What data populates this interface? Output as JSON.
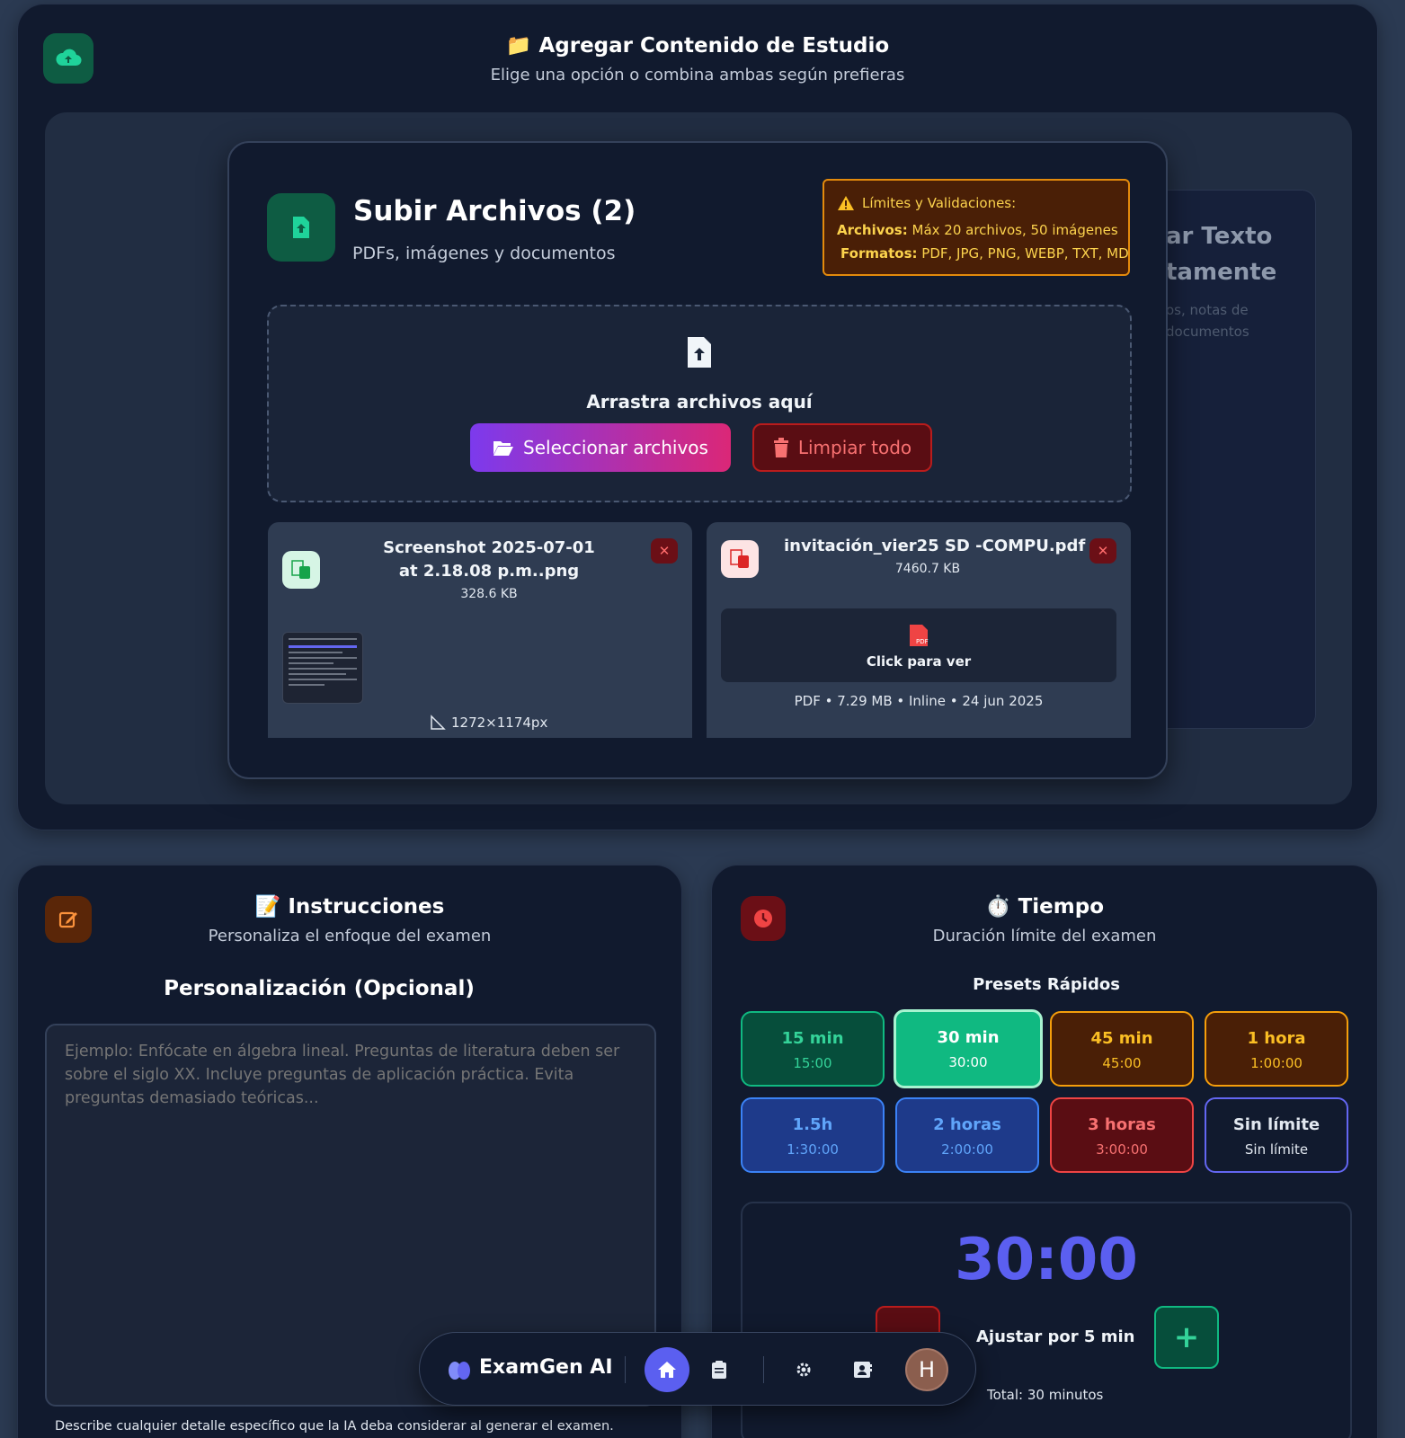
{
  "upload_section": {
    "title": "📁 Agregar Contenido de Estudio",
    "subtitle": "Elige una opción o combina ambas según prefieras",
    "card": {
      "title": "Subir Archivos (2)",
      "subtitle": "PDFs, imágenes y documentos",
      "limits": {
        "heading": "Límites y Validaciones:",
        "files_label": "Archivos:",
        "files_value": "Máx 20 archivos, 50 imágenes",
        "formats_label": "Formatos:",
        "formats_value": "PDF, JPG, PNG, WEBP, TXT, MD"
      },
      "dropzone": {
        "text": "Arrastra archivos aquí",
        "select_label": "Seleccionar archivos",
        "clear_label": "Limpiar todo"
      },
      "files": [
        {
          "name": "Screenshot 2025-07-01 at 2.18.08 p.m..png",
          "size": "328.6 KB",
          "dimensions": "1272×1174px"
        },
        {
          "name": "invitación_vier25 SD -COMPU.pdf",
          "size": "7460.7 KB",
          "preview_label": "Click para ver",
          "meta": "PDF • 7.29 MB • Inline • 24 jun 2025"
        }
      ]
    },
    "text_card_peek": {
      "line1": "ar Texto",
      "line2": "tamente",
      "line3": "os, notas de",
      "line4": "documentos"
    }
  },
  "instructions": {
    "title": "📝 Instrucciones",
    "subtitle": "Personaliza el enfoque del examen",
    "label": "Personalización (Opcional)",
    "placeholder": "Ejemplo: Enfócate en álgebra lineal. Preguntas de literatura deben ser sobre el siglo XX. Incluye preguntas de aplicación práctica. Evita preguntas demasiado teóricas...",
    "hint": "Describe cualquier detalle específico que la IA deba considerar al generar el examen."
  },
  "time": {
    "title": "⏱️ Tiempo",
    "subtitle": "Duración límite del examen",
    "presets_label": "Presets Rápidos",
    "presets": [
      {
        "label": "15 min",
        "value": "15:00"
      },
      {
        "label": "30 min",
        "value": "30:00"
      },
      {
        "label": "45 min",
        "value": "45:00"
      },
      {
        "label": "1 hora",
        "value": "1:00:00"
      },
      {
        "label": "1.5h",
        "value": "1:30:00"
      },
      {
        "label": "2 horas",
        "value": "2:00:00"
      },
      {
        "label": "3 horas",
        "value": "3:00:00"
      },
      {
        "label": "Sin límite",
        "value": "Sin límite"
      }
    ],
    "selected_preset": "30 min",
    "display": "30:00",
    "adjust_label": "Ajustar por 5 min",
    "total": "Total: 30 minutos",
    "plus": "+"
  },
  "nav": {
    "brand": "ExamGen AI",
    "avatar_initial": "H"
  },
  "colors": {
    "accent": "#5b5ff0",
    "green": "#10b981",
    "red": "#dc2626",
    "amber": "#f59e0b"
  }
}
